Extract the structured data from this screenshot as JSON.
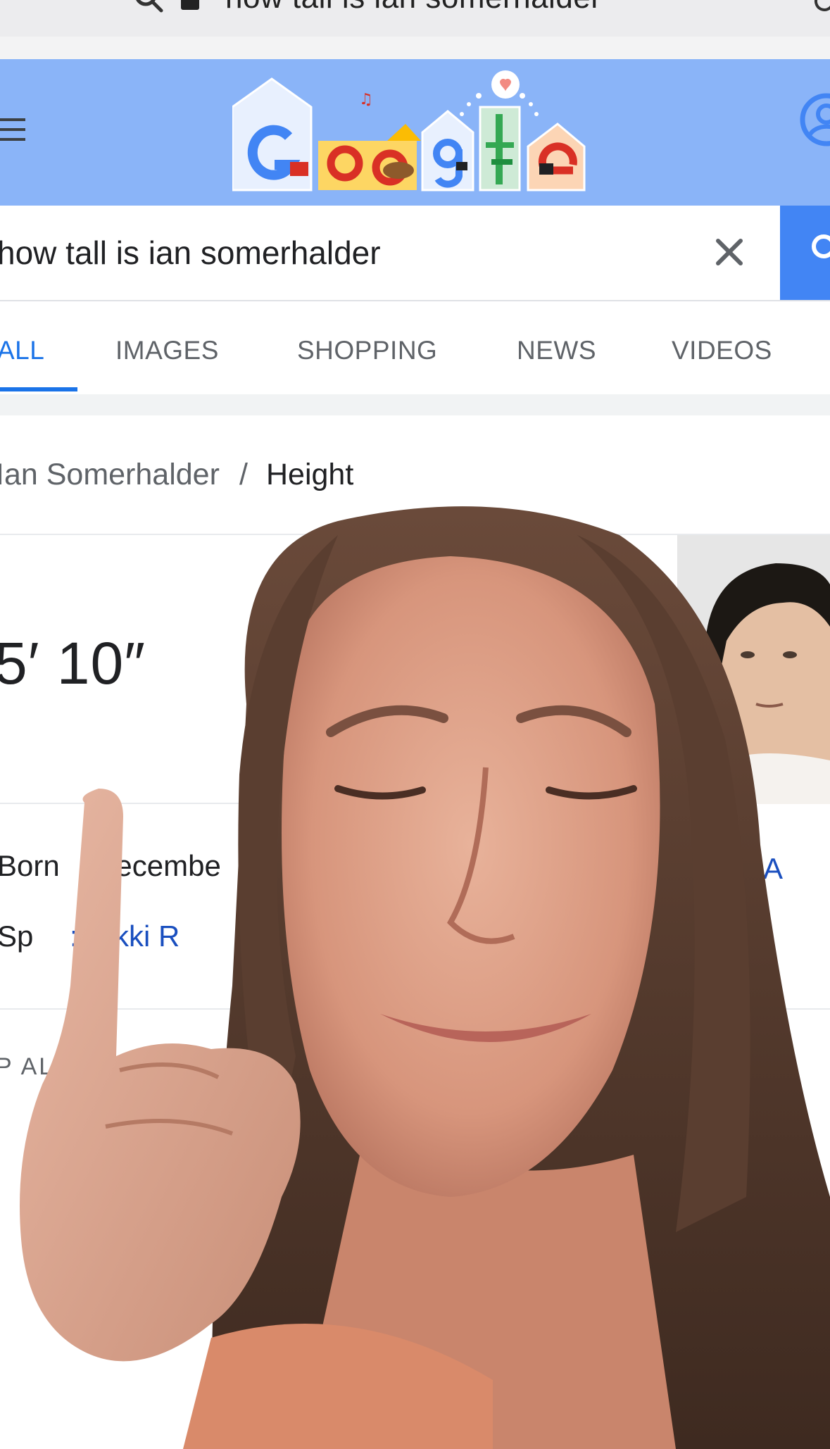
{
  "browser": {
    "url_text": "how tall is ian somerhalder",
    "search_icon": "search-icon",
    "lock_icon": "lock-icon",
    "reload_icon": "reload-icon"
  },
  "header": {
    "menu_icon": "hamburger-menu-icon",
    "logo": "Google",
    "account_icon": "account-circle-icon",
    "background": "#8ab4f8"
  },
  "search": {
    "query": "how tall is ian somerhalder",
    "clear_icon": "close-icon",
    "button_color": "#4285f4"
  },
  "tabs": [
    {
      "label": "ALL",
      "active": true
    },
    {
      "label": "IMAGES",
      "active": false
    },
    {
      "label": "SHOPPING",
      "active": false
    },
    {
      "label": "NEWS",
      "active": false
    },
    {
      "label": "VIDEOS",
      "active": false
    }
  ],
  "panel": {
    "breadcrumb_parent": "Ian Somerhalder",
    "breadcrumb_sep": "/",
    "breadcrumb_current": "Height",
    "answer": "5′ 10″",
    "facts": {
      "born_label": "Born",
      "born_value": "ecembe",
      "spouse_label": "Sp",
      "spouse_value": ": Nikki R",
      "country_fragment": "A"
    },
    "people_also": "P      AL S"
  },
  "accent": "#1a73e8"
}
